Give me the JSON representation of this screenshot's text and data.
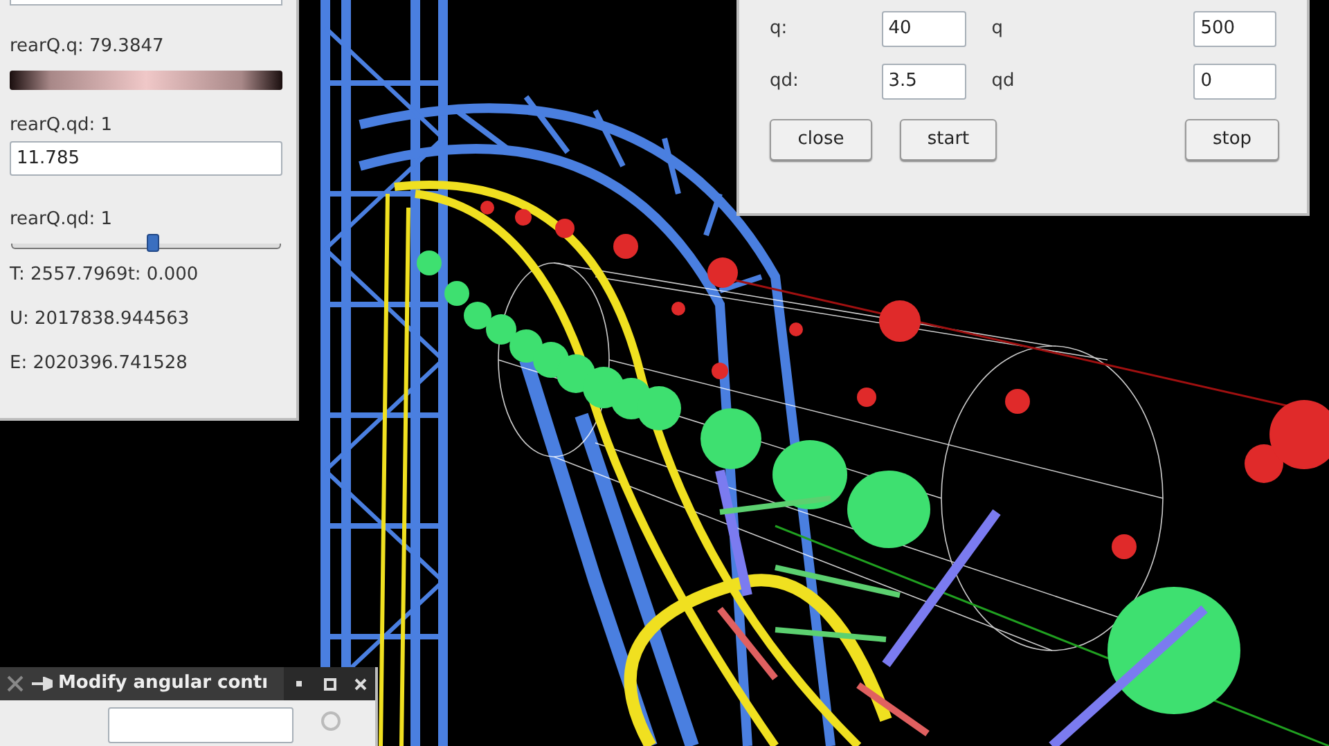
{
  "left_panel": {
    "q_label": "rearQ.q: 79.3847",
    "qd_field": {
      "label": "rearQ.qd: 1",
      "value": "11.785"
    },
    "qd_slider": {
      "label": "rearQ.qd: 1",
      "level": 0.53
    },
    "readouts": [
      "T: 2557.7969t: 0.000",
      "U: 2017838.944563",
      "E: 2020396.741528"
    ]
  },
  "control_panel": {
    "rows": [
      {
        "label": "q:",
        "value": "40",
        "label_2": "q",
        "value_2": "500"
      },
      {
        "label": "qd:",
        "value": "3.5",
        "label_2": "qd",
        "value_2": "0"
      }
    ],
    "buttons": [
      "close",
      "start",
      "stop"
    ]
  },
  "bottom_window": {
    "title": "Modify angular contı"
  }
}
